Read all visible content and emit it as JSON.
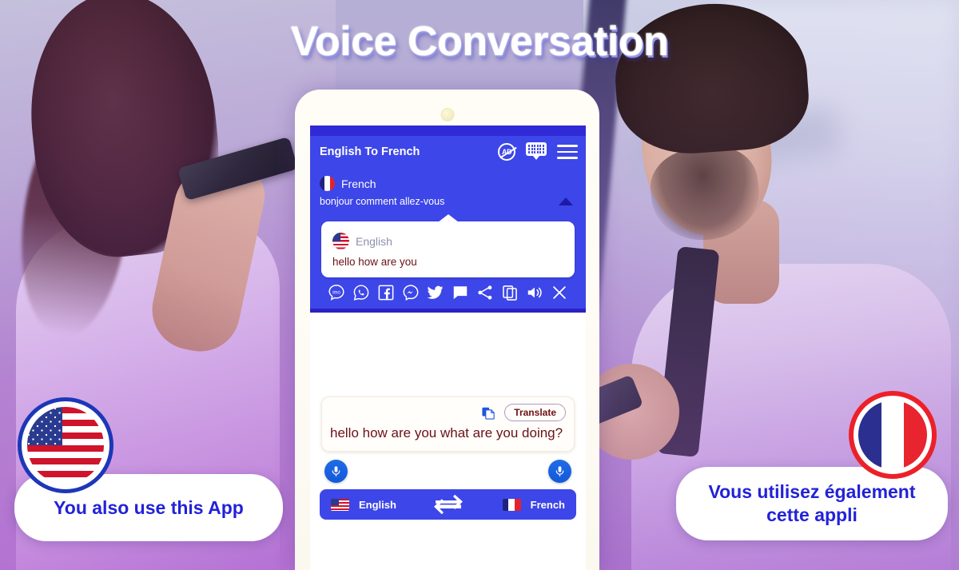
{
  "header": {
    "title": "Voice Conversation"
  },
  "phone": {
    "appbar": {
      "title": "English To French",
      "icons": [
        "no-ads-icon",
        "keyboard-icon",
        "hamburger-menu-icon"
      ],
      "ad_label": "AD"
    },
    "conversation": {
      "target_lang": "French",
      "target_text": "bonjour comment allez-vous",
      "collapse_icon": "caret-up-icon",
      "bubble": {
        "source_lang": "English",
        "source_text": "hello how are you"
      },
      "actions": [
        {
          "name": "imo-icon",
          "label": "imo"
        },
        {
          "name": "whatsapp-icon",
          "label": "WhatsApp"
        },
        {
          "name": "facebook-icon",
          "label": "Facebook"
        },
        {
          "name": "messenger-icon",
          "label": "Messenger"
        },
        {
          "name": "twitter-icon",
          "label": "Twitter"
        },
        {
          "name": "sms-icon",
          "label": "SMS"
        },
        {
          "name": "share-icon",
          "label": "Share"
        },
        {
          "name": "copy-icon",
          "label": "Copy"
        },
        {
          "name": "speaker-icon",
          "label": "Speak"
        },
        {
          "name": "close-icon",
          "label": "Close"
        }
      ]
    },
    "input": {
      "paste_icon": "paste-icon",
      "translate_label": "Translate",
      "text": "hello how are you what are you doing?"
    },
    "mics": {
      "left": "mic-icon",
      "right": "mic-icon"
    },
    "langbar": {
      "source": "English",
      "target": "French",
      "swap_icon": "swap-arrows-icon"
    }
  },
  "badges": {
    "left": {
      "flag": "us-flag",
      "text": "You also use this App"
    },
    "right": {
      "flag": "fr-flag",
      "text": "Vous utilisez également cette appli"
    }
  },
  "colors": {
    "primary_blue": "#3d46e8",
    "dark_blue": "#2a22c4",
    "badge_text": "#2222d8",
    "maroon_text": "#6b1016",
    "mic_blue": "#1558d8"
  }
}
